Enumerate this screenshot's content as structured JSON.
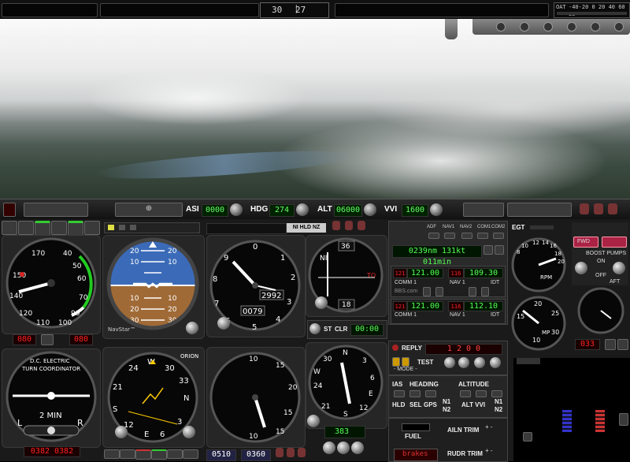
{
  "top": {
    "heading_left": "30",
    "heading_right": "27",
    "oat_label": "OAT",
    "oat_scale": "-40-20  0  20 40 60 80"
  },
  "autopilot": {
    "asi_label": "ASI",
    "asi_value": "0000",
    "hdg_label": "HDG",
    "hdg_value": "274",
    "alt_label": "ALT",
    "alt_value": "06000",
    "vvi_label": "VVI",
    "vvi_value": "1600"
  },
  "panel": {
    "annunciator": "NI  HLD NZ",
    "gps_readout": "0239nm 131kt 011min",
    "com1": {
      "label": "COMM 1",
      "active": "121.00",
      "standby": "121.00"
    },
    "nav1": {
      "label": "NAV 1",
      "active": "116",
      "standby": "109.30",
      "id": "IDT"
    },
    "com2": {
      "label": "COMM 1",
      "active": "121.00",
      "standby": "121.00"
    },
    "nav2": {
      "label": "NAV 1",
      "active": "116",
      "standby": "112.10",
      "id": "IDT"
    },
    "radio_brand": "BBS.com",
    "audio_labels": [
      "ADF",
      "NAV1",
      "NAV2",
      "COM1",
      "COM2"
    ],
    "transponder": {
      "reply": "REPLY",
      "code": "1 2 0 0",
      "test": "TEST",
      "mode": "- MODE -"
    },
    "ap_modes": {
      "ias": "IAS",
      "heading": "HEADING",
      "altitude": "ALTITUDE",
      "hld": "HLD",
      "sel": "SEL",
      "gps": "GPS",
      "altvvi": "ALT VVI",
      "n1": "N1",
      "n2": "N2",
      "n1b": "N1",
      "n2b": "N2"
    },
    "clock": {
      "st": "ST",
      "clr": "CLR",
      "time": "00:00"
    },
    "adf_freq": "383",
    "fuel": "FUEL",
    "brakes": "brakes",
    "ailn_trim": "AILN TRIM",
    "rudr_trim": "RUDR TRIM",
    "egt": "EGT",
    "rpm": "RPM",
    "mp": "MP",
    "boost": "BOOST PUMPS",
    "on": "ON",
    "off": "OFF",
    "aft": "AFT",
    "fwd": "FWD",
    "turn_coord_title": "D.C. ELECTRIC",
    "turn_coord_sub": "TURN COORDINATOR",
    "turn_coord_min": "2 MIN",
    "turn_l": "L",
    "turn_r": "R",
    "hsi_brand": "ORION",
    "ai_brand": "NavStar",
    "altimeter": {
      "baro": "2992",
      "alt": "0079"
    },
    "asi_counter_left": "080",
    "asi_counter_right": "080",
    "hsi_counter": "0382 0382",
    "tach_counter": "033",
    "nav_obs_top": "36",
    "nav_obs_bottom": "18",
    "nav_ni": "NI",
    "nav_to": "TO",
    "adf_bottom_left": "0510",
    "adf_bottom_right": "0360"
  }
}
